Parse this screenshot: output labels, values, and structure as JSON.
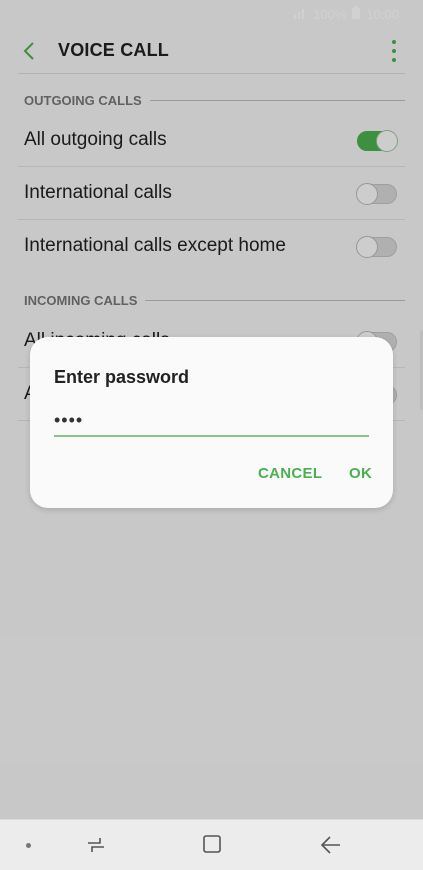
{
  "status_bar": {
    "battery": "100%",
    "time": "10:00"
  },
  "app_bar": {
    "title": "VOICE CALL"
  },
  "sections": {
    "outgoing": {
      "header": "OUTGOING CALLS",
      "items": [
        {
          "label": "All outgoing calls",
          "toggle": "on"
        },
        {
          "label": "International calls",
          "toggle": "off"
        },
        {
          "label": "International calls except home",
          "toggle": "off"
        }
      ]
    },
    "incoming": {
      "header": "INCOMING CALLS",
      "items": [
        {
          "label": "All incoming calls",
          "toggle": "off"
        },
        {
          "label": "A",
          "toggle": "off"
        }
      ]
    }
  },
  "dialog": {
    "title": "Enter password",
    "password_value": "••••",
    "cancel_label": "CANCEL",
    "ok_label": "OK"
  },
  "colors": {
    "accent": "#4caf50",
    "text": "#222222"
  }
}
